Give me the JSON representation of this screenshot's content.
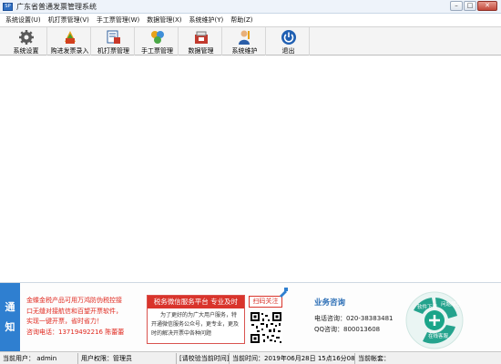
{
  "window": {
    "title": "广东省普通发票管理系统",
    "icon_label": "SP"
  },
  "menu": [
    "系统设置(U)",
    "机打票管理(V)",
    "手工票管理(W)",
    "数据管理(X)",
    "系统维护(Y)",
    "帮助(Z)"
  ],
  "toolbar": [
    {
      "label": "系统设置",
      "icon": "gear-icon"
    },
    {
      "label": "购进发票录入",
      "icon": "invoice-entry-icon"
    },
    {
      "label": "机打票管理",
      "icon": "printer-icon"
    },
    {
      "label": "手工票管理",
      "icon": "handwrite-icon"
    },
    {
      "label": "数据管理",
      "icon": "database-icon"
    },
    {
      "label": "系统维护",
      "icon": "user-maintenance-icon"
    },
    {
      "label": "退出",
      "icon": "power-icon"
    }
  ],
  "notice": {
    "tab_chars": [
      "通",
      "知"
    ],
    "lines": [
      "金蝶金税产品可用万鸿防伪税控接",
      "口无缝对接航信和百望开票软件，",
      "实现一键开票，省时省力！",
      "咨询电话：13719492216 陈蕾蕾"
    ]
  },
  "wechat": {
    "header": "税务微信服务平台  专业及时",
    "body_lines": [
      "为了更好的为广大用户服务，特",
      "开通微信服务公众号，更专业，更及",
      "时的解决开票中各种问题"
    ],
    "scan_label": "扫码关注"
  },
  "business": {
    "title": "业务咨询",
    "phone": "电话咨询：020-38383481",
    "qq": "QQ咨询：800013608"
  },
  "deco_labels": [
    "软件下载",
    "问题解答",
    "在线客服"
  ],
  "status": {
    "user": "当前用户： admin",
    "role": "用户权限：管理员",
    "check_time": "[请校验当前时间]",
    "current_time": "当前时间：2019年06月28日 15点16分08秒",
    "account": "当前帐套："
  },
  "colors": {
    "accent_blue": "#2f7fd0",
    "notice_red": "#e0281e",
    "wx_red": "#d9342b"
  }
}
